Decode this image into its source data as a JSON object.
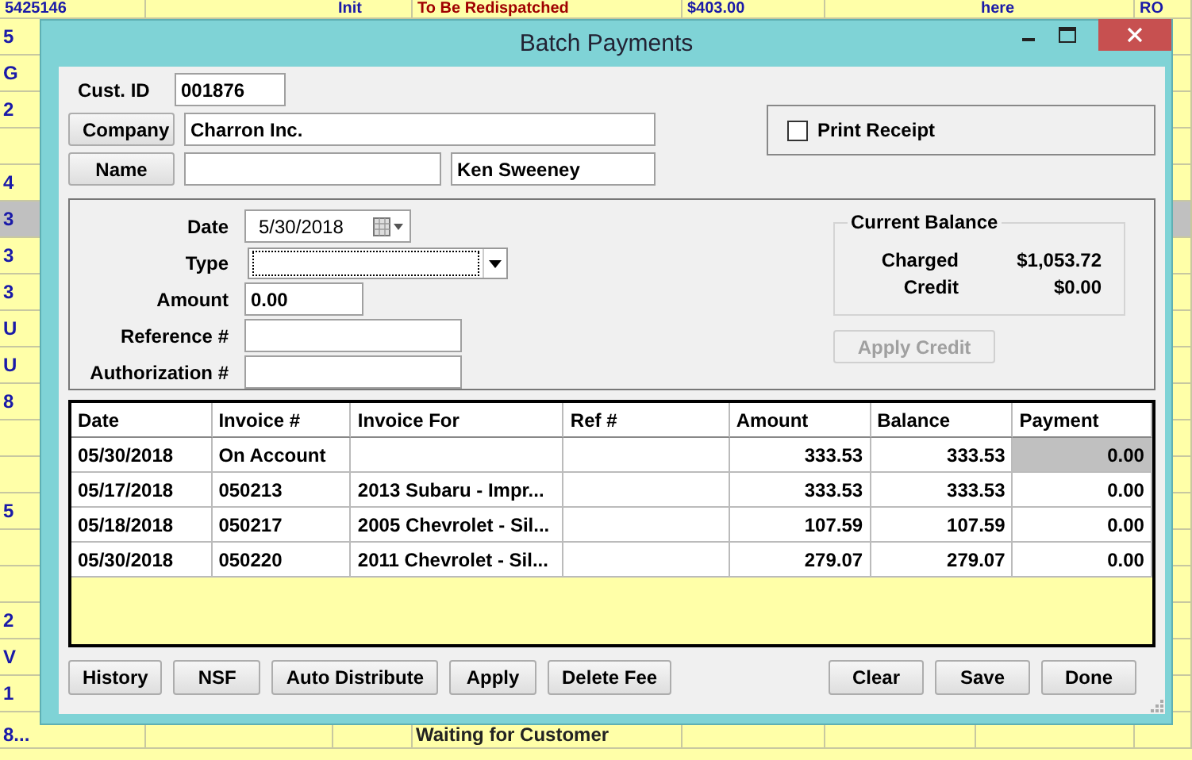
{
  "background": {
    "top_row": {
      "column_1": "5425146",
      "column_3": "Init",
      "column_4": "To Be Redispatched",
      "column_5": "$403.00",
      "column_7": "here",
      "column_8": "RO"
    },
    "rows": [
      {
        "column_1": "5",
        "selected": false
      },
      {
        "column_1": "G",
        "selected": false
      },
      {
        "column_1": "2",
        "selected": false
      },
      {
        "selected": false
      },
      {
        "column_1": "4",
        "selected": false
      },
      {
        "column_1": "3",
        "selected": true
      },
      {
        "column_1": "3",
        "selected": false
      },
      {
        "column_1": "3",
        "selected": false
      },
      {
        "column_1": "U",
        "selected": false
      },
      {
        "column_1": "U",
        "selected": false
      },
      {
        "column_1": "8",
        "selected": false
      },
      {
        "selected": false
      },
      {
        "selected": false
      },
      {
        "column_1": "5",
        "selected": false
      },
      {
        "selected": false
      },
      {
        "selected": false
      },
      {
        "column_1": "2",
        "selected": false
      },
      {
        "column_1": "V",
        "selected": false
      },
      {
        "column_1": "1",
        "selected": false
      },
      {
        "column_1": "8...",
        "column_4": "Waiting for Customer",
        "selected": false
      }
    ]
  },
  "window": {
    "title": "Batch Payments"
  },
  "customer": {
    "cust_id_label": "Cust. ID",
    "cust_id": "001876",
    "company_button": "Company",
    "company": "Charron Inc.",
    "name_button": "Name",
    "last_name": "Ken Sweeney"
  },
  "print_receipt": {
    "label": "Print Receipt",
    "checked": false
  },
  "payment_form": {
    "date_label": "Date",
    "date": "5/30/2018",
    "type_label": "Type",
    "amount_label": "Amount",
    "amount": "0.00",
    "reference_label": "Reference #",
    "authorization_label": "Authorization #"
  },
  "current_balance": {
    "title": "Current Balance",
    "charged_label": "Charged",
    "charged": "$1,053.72",
    "credit_label": "Credit",
    "credit": "$0.00"
  },
  "apply_credit": {
    "label": "Apply Credit",
    "disabled": true
  },
  "table": {
    "columns": [
      "Date",
      "Invoice #",
      "Invoice For",
      "Ref #",
      "Amount",
      "Balance",
      "Payment"
    ],
    "rows": [
      {
        "cells": [
          "05/30/2018",
          "On Account",
          null,
          null,
          "333.53",
          "333.53",
          "0.00"
        ],
        "selected": true
      },
      {
        "cells": [
          "05/17/2018",
          "050213",
          "2013 Subaru - Impr...",
          null,
          "333.53",
          "333.53",
          "0.00"
        ],
        "selected": false
      },
      {
        "cells": [
          "05/18/2018",
          "050217",
          "2005 Chevrolet - Sil...",
          null,
          "107.59",
          "107.59",
          "0.00"
        ],
        "selected": false
      },
      {
        "cells": [
          "05/30/2018",
          "050220",
          "2011 Chevrolet - Sil...",
          null,
          "279.07",
          "279.07",
          "0.00"
        ],
        "selected": false
      }
    ]
  },
  "left_buttons": [
    "History",
    "NSF",
    "Auto Distribute",
    "Apply",
    "Delete Fee"
  ],
  "right_buttons": [
    "Clear",
    "Save",
    "Done"
  ]
}
